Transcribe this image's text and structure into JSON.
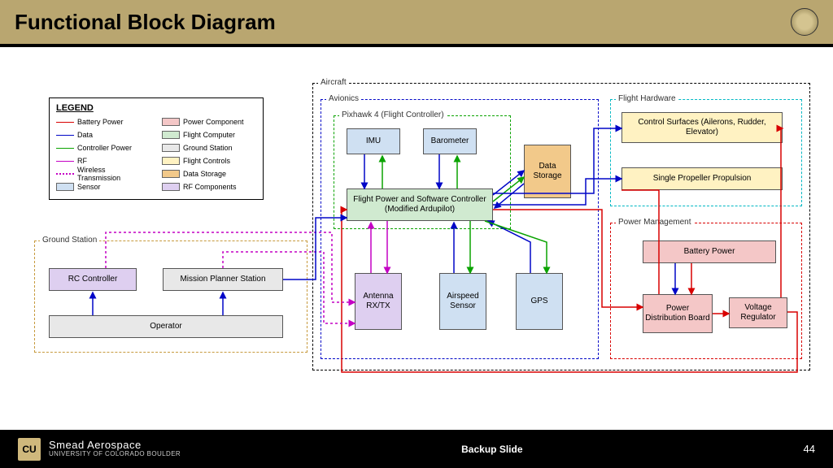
{
  "title": "Functional Block Diagram",
  "footer": {
    "org1": "Smead Aerospace",
    "org2": "UNIVERSITY OF COLORADO BOULDER",
    "center": "Backup Slide",
    "page": "44",
    "cu": "CU"
  },
  "legend": {
    "title": "LEGEND",
    "left": [
      {
        "label": "Battery Power",
        "color": "#d80000"
      },
      {
        "label": "Data",
        "color": "#0006c7"
      },
      {
        "label": "Controller Power",
        "color": "#0aa300"
      },
      {
        "label": "RF",
        "color": "#c400c4"
      },
      {
        "label": "Wireless Transmission",
        "color": "#c400c4",
        "dashed": true
      },
      {
        "label": "Sensor",
        "fill": "#cfe0f2"
      }
    ],
    "right": [
      {
        "label": "Power Component",
        "fill": "#f4c7c7"
      },
      {
        "label": "Flight Computer",
        "fill": "#d0ead0"
      },
      {
        "label": "Ground Station",
        "fill": "#e8e8e8"
      },
      {
        "label": "Flight Controls",
        "fill": "#fff2c2"
      },
      {
        "label": "Data Storage",
        "fill": "#f2c98a"
      },
      {
        "label": "RF Components",
        "fill": "#decff0"
      }
    ]
  },
  "groups": {
    "aircraft": "Aircraft",
    "avionics": "Avionics",
    "pixhawk": "Pixhawk 4 (Flight Controller)",
    "ground": "Ground Station",
    "flightHw": "Flight Hardware",
    "powerMgmt": "Power Management"
  },
  "blocks": {
    "imu": "IMU",
    "baro": "Barometer",
    "fpsc1": "Flight Power and Software Controller",
    "fpsc2": "(Modified Ardupilot)",
    "dataStorage": "Data Storage",
    "antenna": "Antenna RX/TX",
    "airspeed": "Airspeed Sensor",
    "gps": "GPS",
    "rc": "RC Controller",
    "mps": "Mission Planner Station",
    "operator": "Operator",
    "ctrlSurf": "Control Surfaces (Ailerons, Rudder, Elevator)",
    "prop": "Single Propeller Propulsion",
    "battery": "Battery Power",
    "pdb": "Power Distribution Board",
    "vreg": "Voltage Regulator"
  },
  "colors": {
    "sensor": "#cfe0f2",
    "powerComp": "#f4c7c7",
    "flightComp": "#d0ead0",
    "groundStation": "#e8e8e8",
    "flightCtrl": "#fff2c2",
    "dataStore": "#f2c98a",
    "rfComp": "#decff0"
  }
}
